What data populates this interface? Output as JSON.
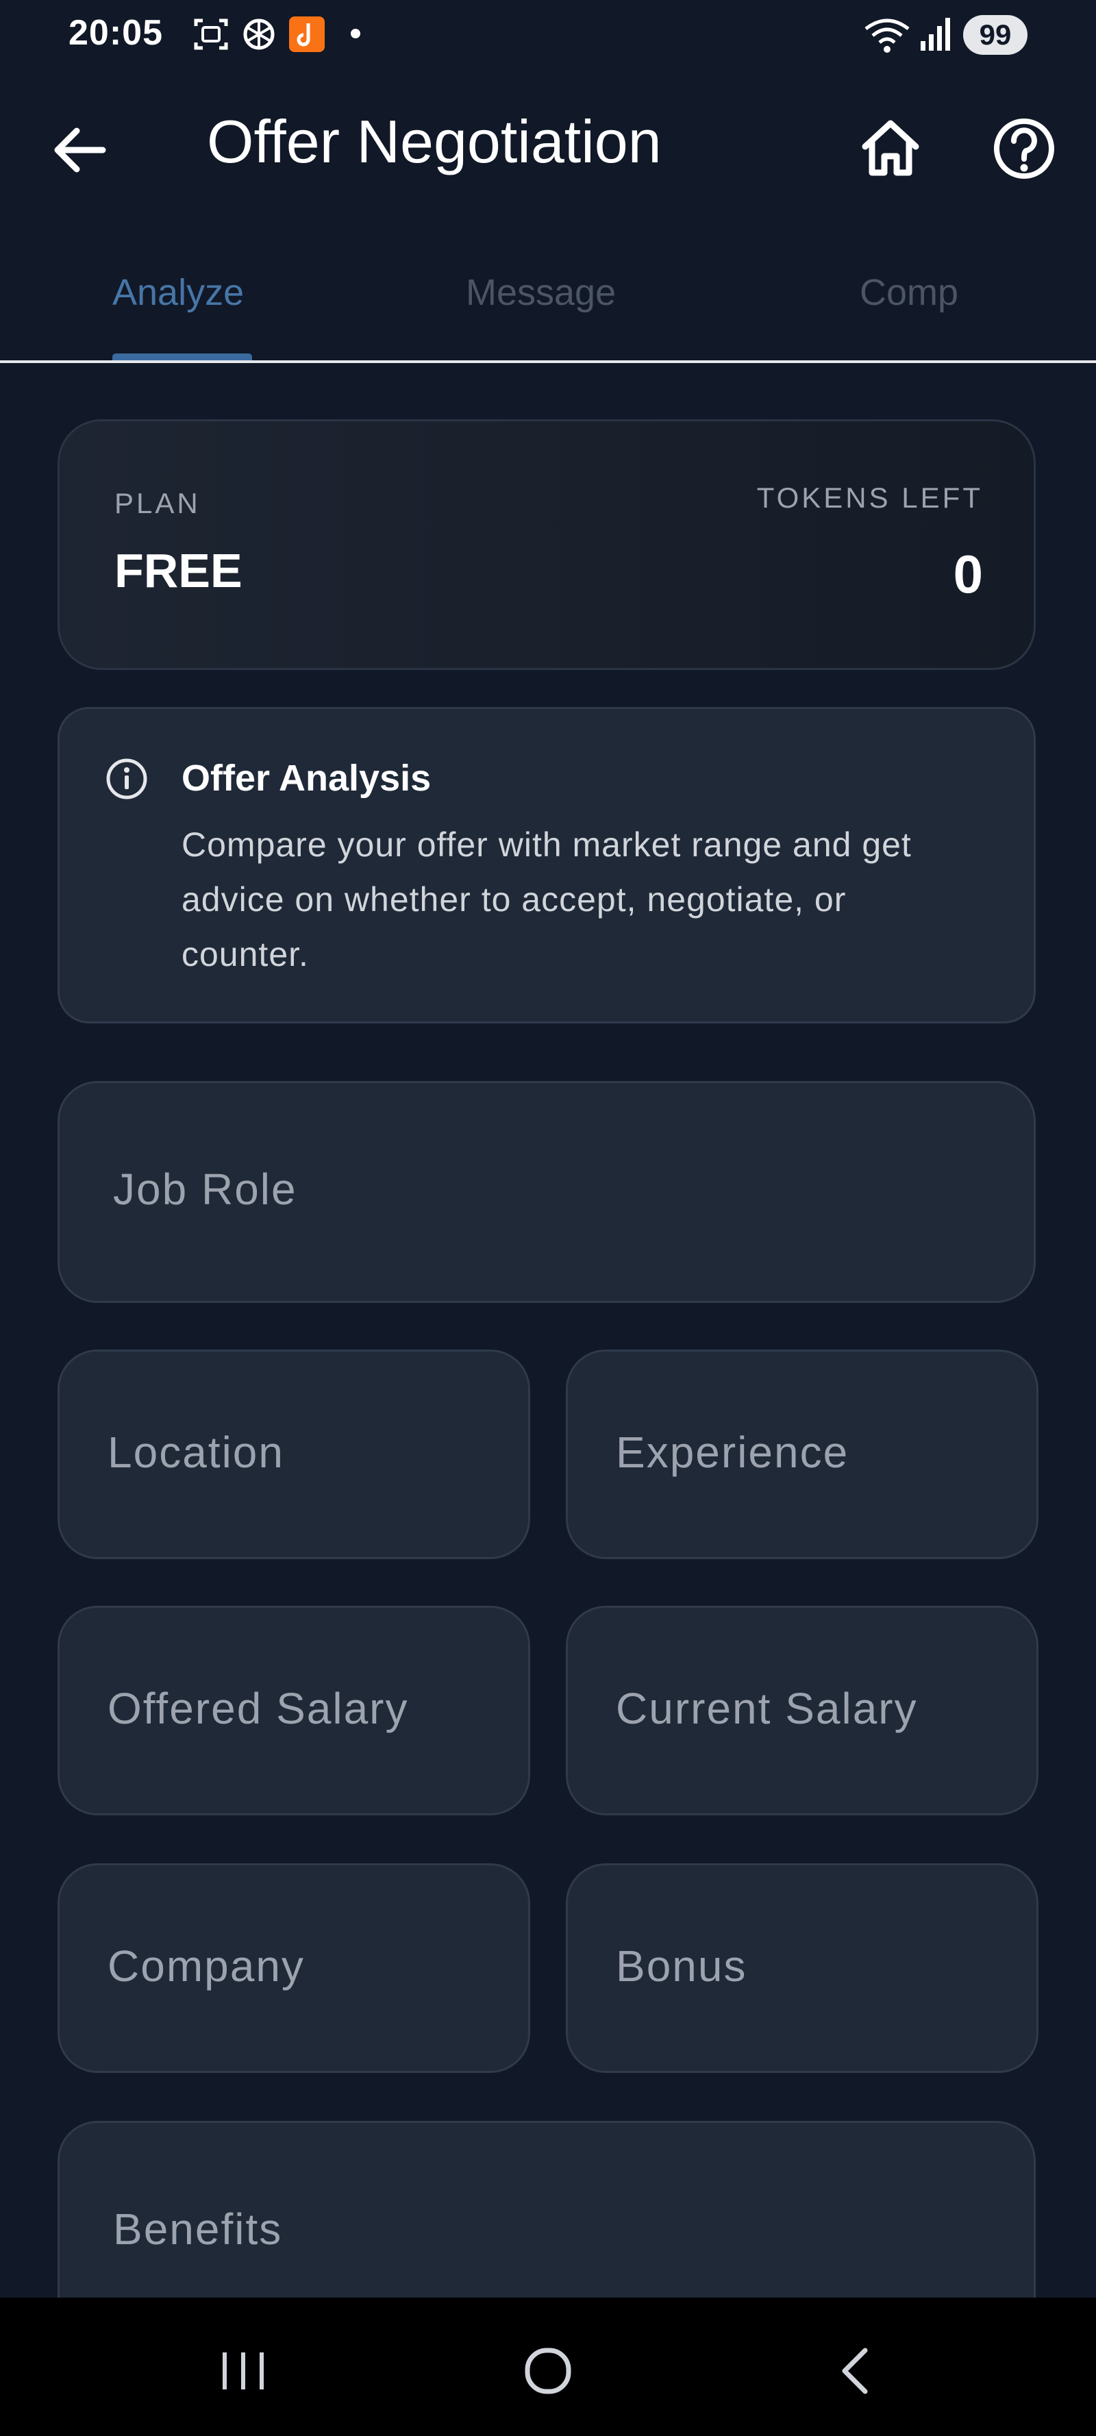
{
  "status_bar": {
    "time": "20:05",
    "battery": "99",
    "icons": [
      "screenshot-icon",
      "openai-icon",
      "app-notification-icon",
      "dot-icon",
      "wifi-icon",
      "signal-icon"
    ]
  },
  "app_bar": {
    "title": "Offer Negotiation",
    "back_icon": "arrow-left-icon",
    "home_icon": "home-icon",
    "help_icon": "help-circle-icon"
  },
  "tabs": [
    {
      "label": "Analyze",
      "active": true
    },
    {
      "label": "Message",
      "active": false
    },
    {
      "label": "Comp",
      "active": false
    }
  ],
  "plan": {
    "plan_label": "PLAN",
    "plan_value": "FREE",
    "tokens_label": "TOKENS LEFT",
    "tokens_value": "0"
  },
  "info": {
    "title": "Offer Analysis",
    "body": "Compare your offer with market range and get advice on whether to accept, negotiate, or counter."
  },
  "form": {
    "job_role": "Job Role",
    "location": "Location",
    "experience": "Experience",
    "offered_salary": "Offered Salary",
    "current_salary": "Current Salary",
    "company": "Company",
    "bonus": "Bonus",
    "benefits": "Benefits"
  },
  "colors": {
    "background": "#111827",
    "card": "#1f2937",
    "accent": "#4776a7",
    "muted_text": "#9ca3af"
  }
}
